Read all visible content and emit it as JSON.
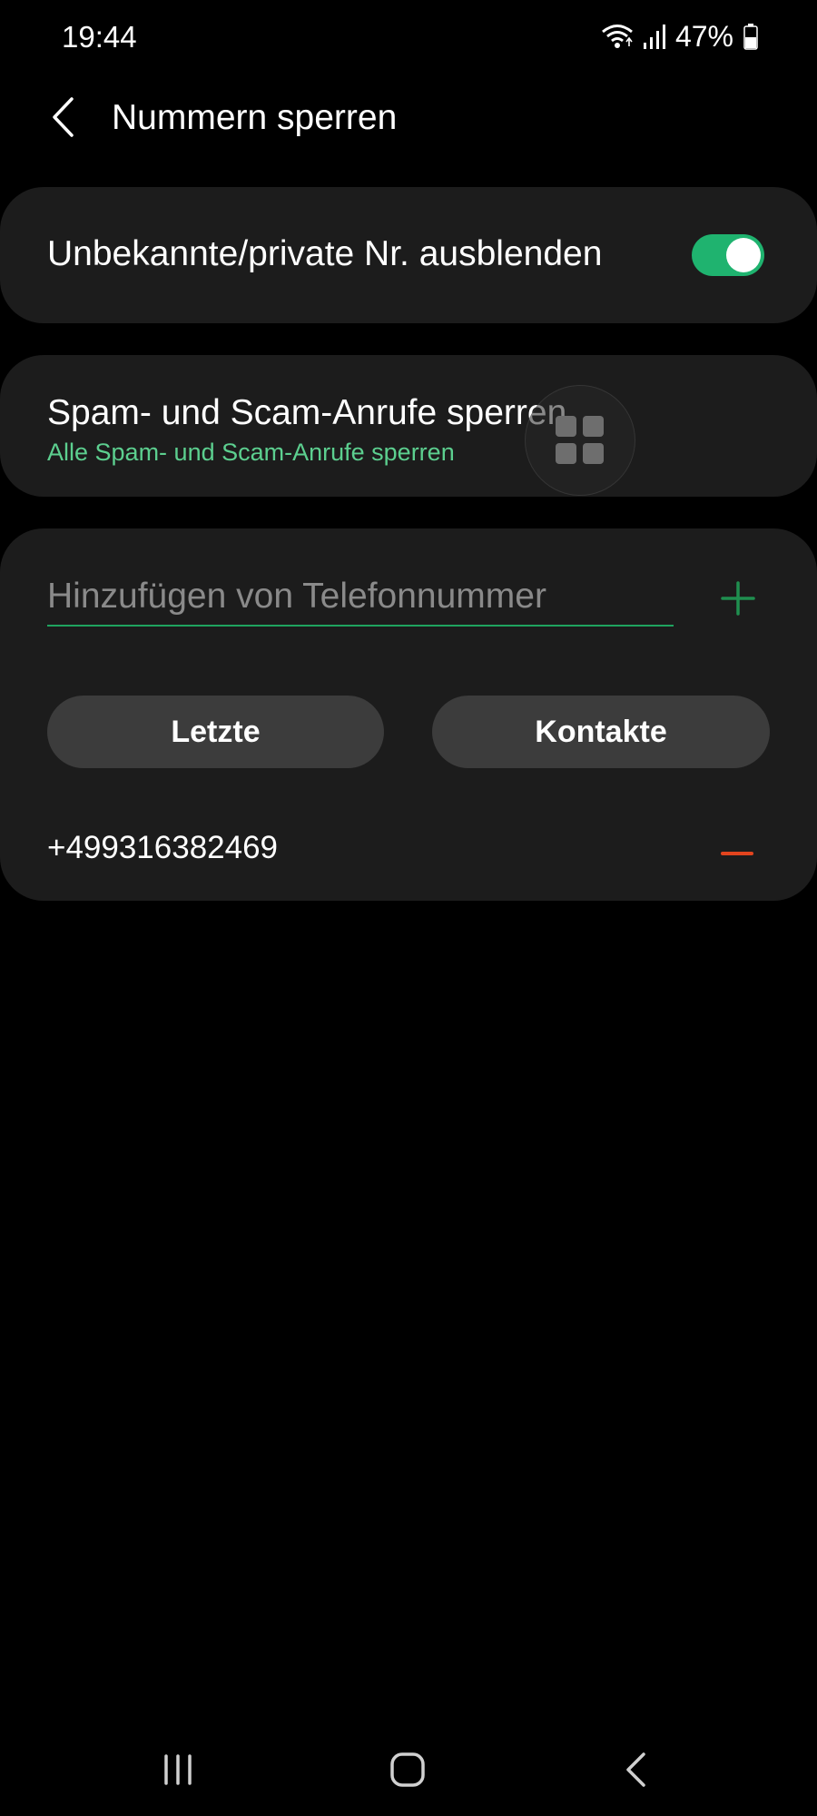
{
  "status_bar": {
    "time": "19:44",
    "battery": "47%",
    "icons": [
      "wifi-icon",
      "signal-icon",
      "battery-icon"
    ]
  },
  "header": {
    "title": "Nummern sperren",
    "back_icon": "chevron-left-icon"
  },
  "toggle_card": {
    "label": "Unbekannte/private Nr. ausblenden",
    "enabled": true
  },
  "spam_card": {
    "title": "Spam- und Scam-Anrufe sperren",
    "subtitle": "Alle Spam- und Scam-Anrufe sperren"
  },
  "numbers_card": {
    "input_value": "",
    "input_placeholder": "Hinzufügen von Telefonnummer",
    "recent_button": "Letzte",
    "contacts_button": "Kontakte",
    "blocked_numbers": [
      "+499316382469"
    ]
  },
  "nav_bar": {
    "icons": [
      "recent-apps-icon",
      "home-icon",
      "back-icon"
    ]
  },
  "colors": {
    "background": "#000000",
    "card": "#1c1c1c",
    "accent_green": "#1fb36f",
    "subtitle_green": "#5ccf8f",
    "remove_red": "#e2441e",
    "button_gray": "#3c3c3c"
  }
}
